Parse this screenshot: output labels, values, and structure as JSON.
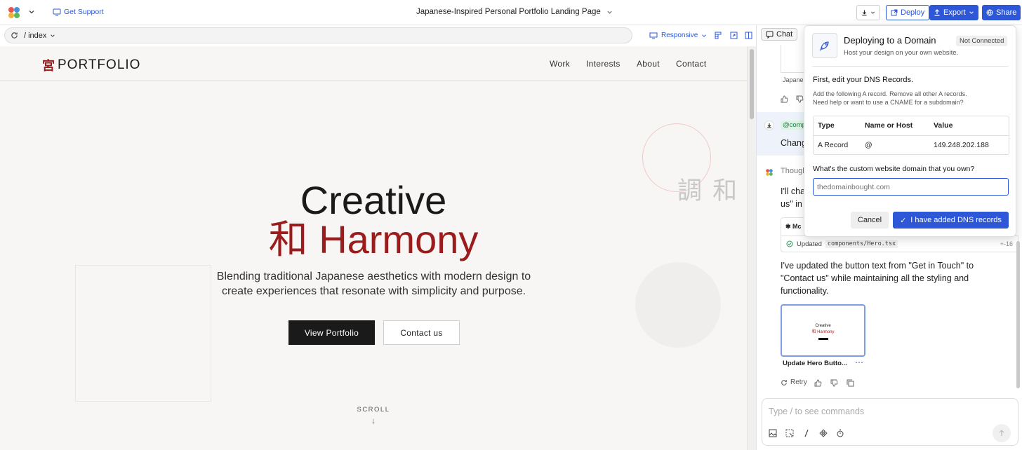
{
  "topbar": {
    "get_support": "Get Support",
    "title": "Japanese-Inspired Personal Portfolio Landing Page",
    "deploy": "Deploy",
    "export": "Export",
    "share": "Share",
    "chat_tab": "Chat"
  },
  "addressbar": {
    "path": "/ index",
    "responsive": "Responsive"
  },
  "site": {
    "brand_kanji": "宮",
    "brand": "PORTFOLIO",
    "nav": [
      "Work",
      "Interests",
      "About",
      "Contact"
    ],
    "hero_line1": "Creative",
    "hero_kanji": "和",
    "hero_line2": "Harmony",
    "deco_kanji": "調 和",
    "subtitle": "Blending traditional Japanese aesthetics with modern design to create experiences that resonate with simplicity and purpose.",
    "btn_portfolio": "View Portfolio",
    "btn_contact": "Contact us",
    "scroll": "SCROLL",
    "scroll_arrow": "↓"
  },
  "chat": {
    "thumb_caption_top": "Japane",
    "mention": "@comp",
    "user_msg_start": "Chang",
    "thought_label": "Though",
    "ai_partial_1": "I'll cha",
    "ai_partial_2": "us\" in",
    "tool_label": "Mc",
    "updated_text": "Updated",
    "updated_file": "components/Hero.tsx",
    "diff_stat": "+-16",
    "ai_msg": "I've updated the button text from \"Get in Touch\" to \"Contact us\" while maintaining all the styling and functionality.",
    "thumb_title": "Creative",
    "thumb_sub": "和 Harmony",
    "thumb_caption": "Update Hero Butto...",
    "more": "⋯",
    "retry": "Retry",
    "input_placeholder": "Type / to see commands"
  },
  "popup": {
    "title": "Deploying to a Domain",
    "status": "Not Connected",
    "subtitle": "Host your design on your own website.",
    "step_title": "First, edit your DNS Records.",
    "step_desc_1": "Add the following A record. Remove all other A records.",
    "step_desc_2": "Need help or want to use a CNAME for a subdomain?",
    "col_type": "Type",
    "col_name": "Name or Host",
    "col_value": "Value",
    "row_type": "A Record",
    "row_name": "@",
    "row_value": "149.248.202.188",
    "domain_question": "What's the custom website domain that you own?",
    "domain_placeholder": "thedomainbought.com",
    "cancel": "Cancel",
    "confirm": "I have added DNS records",
    "check": "✓"
  },
  "colors": {
    "accent_blue": "#2d57d6",
    "brand_red": "#9b1c1c",
    "dark_button": "#1a1a1a"
  }
}
